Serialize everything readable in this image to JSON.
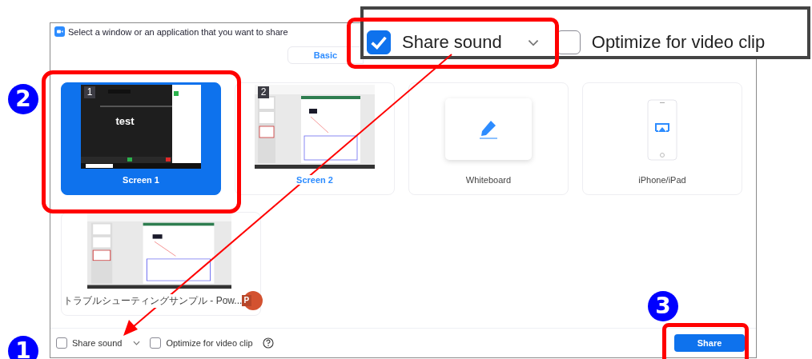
{
  "dialog": {
    "title": "Select a window or an application that you want to share",
    "tabs": [
      {
        "label": "Basic",
        "selected": true
      }
    ],
    "sources": [
      {
        "kind": "screen",
        "badge": "1",
        "preview_text": "test",
        "label": "Screen 1",
        "selected": true
      },
      {
        "kind": "slides",
        "badge": "2",
        "label": "Screen 2",
        "selected": false
      },
      {
        "kind": "whiteboard",
        "label": "Whiteboard",
        "selected": false
      },
      {
        "kind": "phone",
        "label": "iPhone/iPad",
        "selected": false
      },
      {
        "kind": "window",
        "label": "トラブルシューティングサンプル - Pow...",
        "app_letter": "P",
        "selected": false
      }
    ],
    "options": [
      {
        "label": "Share sound",
        "checked": false,
        "dropdown": true
      },
      {
        "label": "Optimize for video clip",
        "checked": false
      }
    ],
    "share_button": "Share"
  },
  "callout": {
    "options": [
      {
        "label": "Share sound",
        "checked": true,
        "dropdown": true
      },
      {
        "label": "Optimize for video clip",
        "checked": false
      }
    ]
  },
  "steps": [
    "1",
    "2",
    "3"
  ]
}
